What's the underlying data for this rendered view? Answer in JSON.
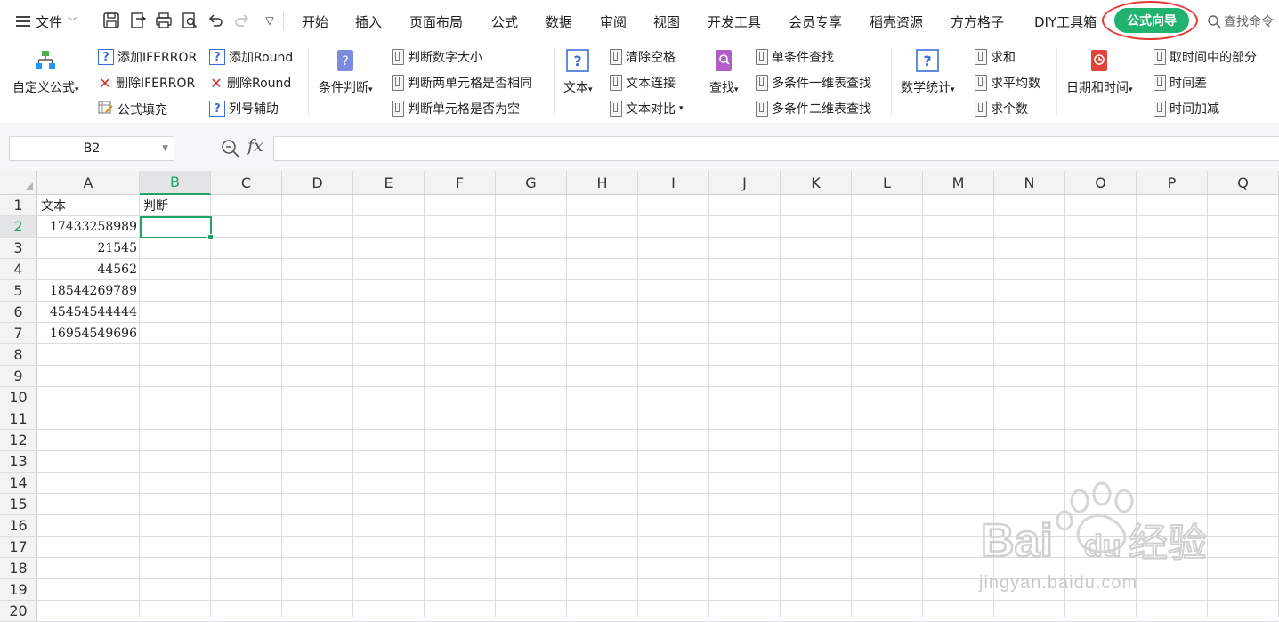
{
  "menu": {
    "file_label": "文件"
  },
  "tabs": [
    "开始",
    "插入",
    "页面布局",
    "公式",
    "数据",
    "审阅",
    "视图",
    "开发工具",
    "会员专享",
    "稻壳资源",
    "方方格子",
    "DIY工具箱"
  ],
  "active_tab": "公式向导",
  "search_command": "查找命令",
  "ribbon": {
    "custom_formula": "自定义公式",
    "add_iferror": "添加IFERROR",
    "del_iferror": "删除IFERROR",
    "formula_fill": "公式填充",
    "add_round": "添加Round",
    "del_round": "删除Round",
    "col_helper": "列号辅助",
    "cond_judge": "条件判断",
    "judge_number_size": "判断数字大小",
    "judge_two_cells_same": "判断两单元格是否相同",
    "judge_cell_empty": "判断单元格是否为空",
    "text": "文本",
    "clear_spaces": "清除空格",
    "text_join": "文本连接",
    "text_compare": "文本对比",
    "lookup": "查找",
    "single_lookup": "单条件查找",
    "multi_1d_lookup": "多条件一维表查找",
    "multi_2d_lookup": "多条件二维表查找",
    "math_stats": "数学统计",
    "sum": "求和",
    "average": "求平均数",
    "count": "求个数",
    "date_time": "日期和时间",
    "extract_time_part": "取时间中的部分",
    "time_diff": "时间差",
    "time_add": "时间加减"
  },
  "formula_bar": {
    "name_box": "B2",
    "fx": "fx",
    "formula": ""
  },
  "columns": [
    "A",
    "B",
    "C",
    "D",
    "E",
    "F",
    "G",
    "H",
    "I",
    "J",
    "K",
    "L",
    "M",
    "N",
    "O",
    "P",
    "Q"
  ],
  "selected_column": "B",
  "rows": [
    "1",
    "2",
    "3",
    "4",
    "5",
    "6",
    "7",
    "8",
    "9",
    "10",
    "11",
    "12",
    "13",
    "14",
    "15",
    "16",
    "17",
    "18",
    "19",
    "20"
  ],
  "selected_row": "2",
  "cells": {
    "A1": "文本",
    "B1": "判断",
    "A2": "17433258989",
    "A3": "21545",
    "A4": "44562",
    "A5": "18544269789",
    "A6": "45454544444",
    "A7": "16954549696"
  },
  "watermark": {
    "logo": "Baidu经验",
    "url": "jingyan.baidu.com"
  },
  "colors": {
    "accent": "#21b26f",
    "highlight_ring": "#e53935",
    "selection": "#21a366"
  }
}
